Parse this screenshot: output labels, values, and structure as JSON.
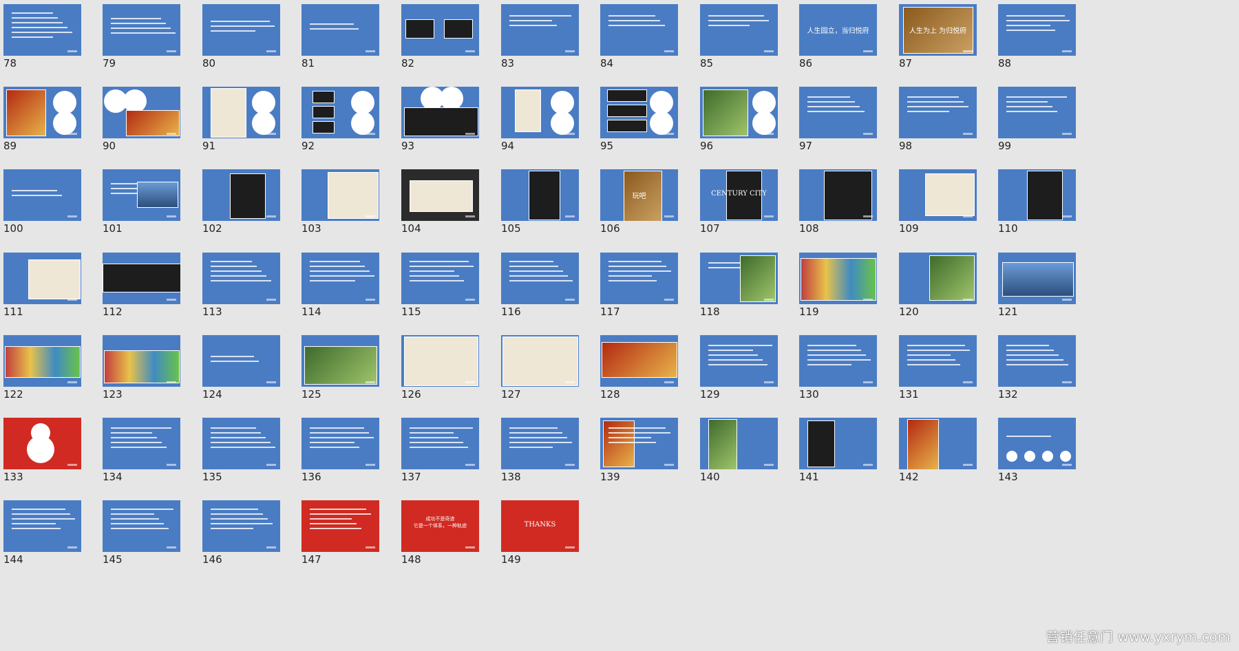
{
  "slides": [
    {
      "number": "78",
      "text": "",
      "bg": "blue"
    },
    {
      "number": "79",
      "text": "",
      "bg": "blue"
    },
    {
      "number": "80",
      "text": "",
      "bg": "blue"
    },
    {
      "number": "81",
      "text": "",
      "bg": "blue"
    },
    {
      "number": "82",
      "text": "",
      "bg": "blue"
    },
    {
      "number": "83",
      "text": "",
      "bg": "blue"
    },
    {
      "number": "84",
      "text": "",
      "bg": "blue"
    },
    {
      "number": "85",
      "text": "",
      "bg": "blue"
    },
    {
      "number": "86",
      "text": "人生园立，当归悦府",
      "bg": "blue"
    },
    {
      "number": "87",
      "text": "人生为上 为归悦府",
      "bg": "gold"
    },
    {
      "number": "88",
      "text": "",
      "bg": "blue"
    },
    {
      "number": "89",
      "text": "",
      "bg": "blue"
    },
    {
      "number": "90",
      "text": "",
      "bg": "blue"
    },
    {
      "number": "91",
      "text": "",
      "bg": "blue"
    },
    {
      "number": "92",
      "text": "",
      "bg": "blue"
    },
    {
      "number": "93",
      "text": "",
      "bg": "blue"
    },
    {
      "number": "94",
      "text": "",
      "bg": "blue"
    },
    {
      "number": "95",
      "text": "",
      "bg": "blue"
    },
    {
      "number": "96",
      "text": "",
      "bg": "blue"
    },
    {
      "number": "97",
      "text": "",
      "bg": "blue"
    },
    {
      "number": "98",
      "text": "",
      "bg": "blue"
    },
    {
      "number": "99",
      "text": "",
      "bg": "blue"
    },
    {
      "number": "100",
      "text": "",
      "bg": "blue"
    },
    {
      "number": "101",
      "text": "",
      "bg": "blue"
    },
    {
      "number": "102",
      "text": "",
      "bg": "blue"
    },
    {
      "number": "103",
      "text": "",
      "bg": "blue"
    },
    {
      "number": "104",
      "text": "",
      "bg": "dark"
    },
    {
      "number": "105",
      "text": "",
      "bg": "blue"
    },
    {
      "number": "106",
      "text": "玩吧",
      "bg": "blue"
    },
    {
      "number": "107",
      "text": "CENTURY CITY",
      "bg": "blue"
    },
    {
      "number": "108",
      "text": "",
      "bg": "blue"
    },
    {
      "number": "109",
      "text": "",
      "bg": "blue"
    },
    {
      "number": "110",
      "text": "",
      "bg": "blue"
    },
    {
      "number": "111",
      "text": "",
      "bg": "blue"
    },
    {
      "number": "112",
      "text": "",
      "bg": "blue"
    },
    {
      "number": "113",
      "text": "",
      "bg": "blue"
    },
    {
      "number": "114",
      "text": "",
      "bg": "blue"
    },
    {
      "number": "115",
      "text": "",
      "bg": "blue"
    },
    {
      "number": "116",
      "text": "",
      "bg": "blue"
    },
    {
      "number": "117",
      "text": "",
      "bg": "blue"
    },
    {
      "number": "118",
      "text": "",
      "bg": "blue"
    },
    {
      "number": "119",
      "text": "",
      "bg": "blue"
    },
    {
      "number": "120",
      "text": "",
      "bg": "blue"
    },
    {
      "number": "121",
      "text": "",
      "bg": "blue"
    },
    {
      "number": "122",
      "text": "",
      "bg": "blue"
    },
    {
      "number": "123",
      "text": "",
      "bg": "blue"
    },
    {
      "number": "124",
      "text": "",
      "bg": "blue"
    },
    {
      "number": "125",
      "text": "",
      "bg": "blue"
    },
    {
      "number": "126",
      "text": "",
      "bg": "blue"
    },
    {
      "number": "127",
      "text": "",
      "bg": "blue"
    },
    {
      "number": "128",
      "text": "",
      "bg": "blue"
    },
    {
      "number": "129",
      "text": "",
      "bg": "blue"
    },
    {
      "number": "130",
      "text": "",
      "bg": "blue"
    },
    {
      "number": "131",
      "text": "",
      "bg": "blue"
    },
    {
      "number": "132",
      "text": "",
      "bg": "blue"
    },
    {
      "number": "133",
      "text": "",
      "bg": "red"
    },
    {
      "number": "134",
      "text": "",
      "bg": "blue"
    },
    {
      "number": "135",
      "text": "",
      "bg": "blue"
    },
    {
      "number": "136",
      "text": "",
      "bg": "blue"
    },
    {
      "number": "137",
      "text": "",
      "bg": "blue"
    },
    {
      "number": "138",
      "text": "",
      "bg": "blue"
    },
    {
      "number": "139",
      "text": "",
      "bg": "blue"
    },
    {
      "number": "140",
      "text": "",
      "bg": "blue"
    },
    {
      "number": "141",
      "text": "",
      "bg": "blue"
    },
    {
      "number": "142",
      "text": "",
      "bg": "blue"
    },
    {
      "number": "143",
      "text": "",
      "bg": "blue"
    },
    {
      "number": "144",
      "text": "",
      "bg": "blue"
    },
    {
      "number": "145",
      "text": "",
      "bg": "blue"
    },
    {
      "number": "146",
      "text": "",
      "bg": "blue"
    },
    {
      "number": "147",
      "text": "",
      "bg": "red"
    },
    {
      "number": "148",
      "text": "成功不是奇迹\n它是一个体系，一种轨迹",
      "bg": "red"
    },
    {
      "number": "149",
      "text": "THANKS",
      "bg": "red"
    }
  ],
  "watermark": "营销任意门 www.yxrym.com",
  "colors": {
    "canvas": "#e6e6e6",
    "slide_blue": "#4a7cc4",
    "slide_red": "#d02a22"
  }
}
